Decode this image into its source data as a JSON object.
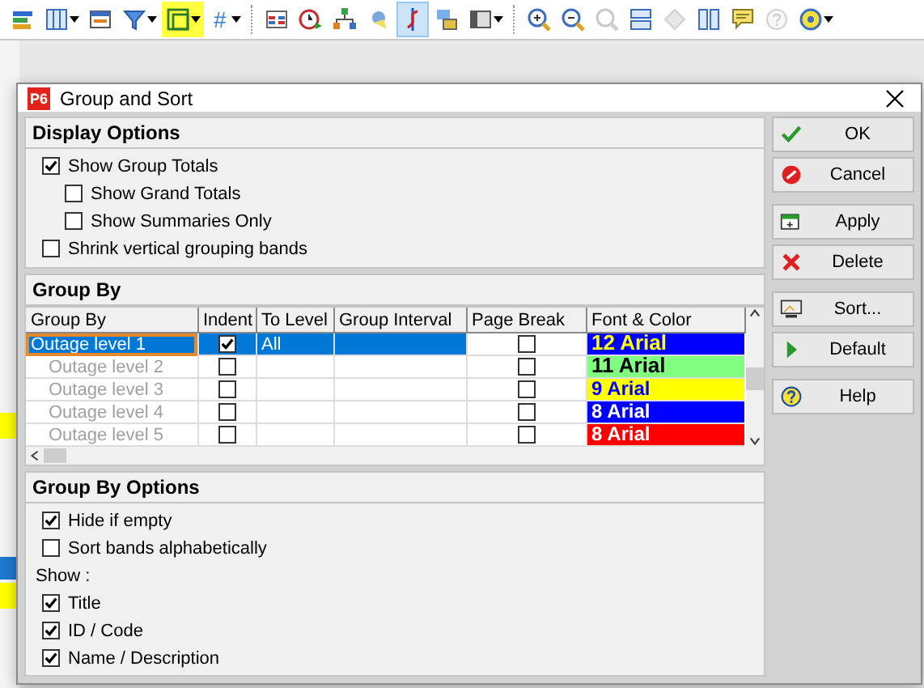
{
  "toolbar_groups": [
    [
      {
        "dropdown": false,
        "highlighted": false,
        "pressed": false,
        "disabled": false
      },
      {
        "dropdown": true,
        "highlighted": false,
        "pressed": false,
        "disabled": false
      },
      {
        "dropdown": false,
        "highlighted": false,
        "pressed": false,
        "disabled": false
      },
      {
        "dropdown": true,
        "highlighted": false,
        "pressed": false,
        "disabled": false
      },
      {
        "dropdown": true,
        "highlighted": true,
        "pressed": false,
        "disabled": false
      },
      {
        "glyph": "#",
        "dropdown": true,
        "highlighted": false,
        "pressed": false,
        "disabled": false
      }
    ],
    [
      {
        "dropdown": false,
        "highlighted": false,
        "pressed": false,
        "disabled": false
      },
      {
        "dropdown": false,
        "highlighted": false,
        "pressed": false,
        "disabled": false
      },
      {
        "dropdown": false,
        "highlighted": false,
        "pressed": false,
        "disabled": false
      },
      {
        "dropdown": false,
        "highlighted": false,
        "pressed": false,
        "disabled": false
      },
      {
        "dropdown": false,
        "highlighted": false,
        "pressed": true,
        "disabled": false
      },
      {
        "dropdown": false,
        "highlighted": false,
        "pressed": false,
        "disabled": false
      },
      {
        "dropdown": true,
        "highlighted": false,
        "pressed": false,
        "disabled": false
      }
    ],
    [
      {
        "dropdown": false,
        "highlighted": false,
        "pressed": false,
        "disabled": false
      },
      {
        "dropdown": false,
        "highlighted": false,
        "pressed": false,
        "disabled": false
      },
      {
        "dropdown": false,
        "highlighted": false,
        "pressed": false,
        "disabled": true
      },
      {
        "dropdown": false,
        "highlighted": false,
        "pressed": false,
        "disabled": false
      },
      {
        "dropdown": false,
        "highlighted": false,
        "pressed": false,
        "disabled": true
      },
      {
        "dropdown": false,
        "highlighted": false,
        "pressed": false,
        "disabled": false
      },
      {
        "dropdown": false,
        "highlighted": false,
        "pressed": false,
        "disabled": false
      },
      {
        "dropdown": false,
        "highlighted": false,
        "pressed": false,
        "disabled": true
      },
      {
        "dropdown": true,
        "highlighted": false,
        "pressed": false,
        "disabled": false
      }
    ]
  ],
  "window": {
    "logo": "P6",
    "title": "Group and Sort"
  },
  "display_options": {
    "title": "Display Options",
    "items": [
      {
        "label": "Show Group Totals",
        "checked": true,
        "children": [
          {
            "label": "Show Grand Totals",
            "checked": false
          },
          {
            "label": "Show Summaries Only",
            "checked": false
          }
        ]
      },
      {
        "label": "Shrink vertical grouping bands",
        "checked": false
      }
    ]
  },
  "group_by": {
    "title": "Group By",
    "columns": [
      "Group By",
      "Indent",
      "To Level",
      "Group Interval",
      "Page Break",
      "Font & Color"
    ],
    "rows": [
      {
        "group_by": "Outage level 1",
        "indent": true,
        "to_level": "All",
        "page_break": false,
        "font": {
          "text": "12 Arial",
          "color": "#ffff00"
        },
        "color": "#0000ff",
        "selected": true,
        "disabled": false
      },
      {
        "group_by": "Outage level 2",
        "indent": false,
        "page_break": false,
        "font": {
          "text": "11 Arial",
          "color": "#000000"
        },
        "color": "#80ff80",
        "selected": false,
        "disabled": true
      },
      {
        "group_by": "Outage level 3",
        "indent": false,
        "page_break": false,
        "font": {
          "text": "9 Arial",
          "color": "#0000ff"
        },
        "color": "#ffff00",
        "selected": false,
        "disabled": true
      },
      {
        "group_by": "Outage level 4",
        "indent": false,
        "page_break": false,
        "font": {
          "text": "8 Arial",
          "color": "#ffffff"
        },
        "color": "#0000ff",
        "selected": false,
        "disabled": true
      },
      {
        "group_by": "Outage level 5",
        "indent": false,
        "page_break": false,
        "font": {
          "text": "8 Arial",
          "color": "#ffffff"
        },
        "color": "#ff0000",
        "selected": false,
        "disabled": true
      }
    ]
  },
  "group_by_options": {
    "title": "Group By Options",
    "items": [
      {
        "kind": "checkbox",
        "label": "Hide if empty",
        "checked": true
      },
      {
        "kind": "checkbox",
        "label": "Sort bands alphabetically",
        "checked": false
      },
      {
        "kind": "label",
        "label": "Show :"
      },
      {
        "kind": "checkbox",
        "label": "Title",
        "checked": true
      },
      {
        "kind": "checkbox",
        "label": "ID / Code",
        "checked": true
      },
      {
        "kind": "checkbox",
        "label": "Name / Description",
        "checked": true
      }
    ]
  },
  "button_groups": [
    [
      "OK",
      "Cancel"
    ],
    [
      "Apply",
      "Delete"
    ],
    [
      "Sort...",
      "Default"
    ],
    [
      "Help"
    ]
  ]
}
